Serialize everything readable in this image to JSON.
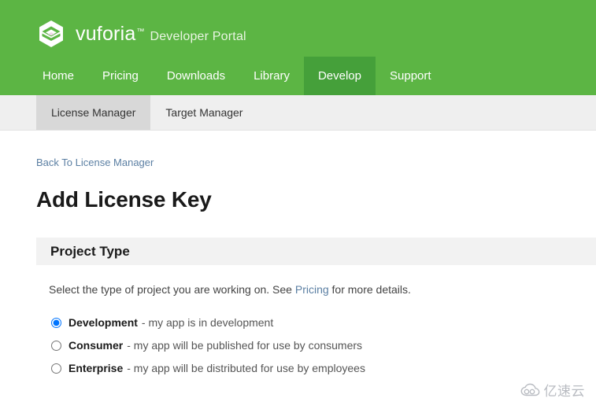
{
  "brand": {
    "logo_icon": "vuforia-hexagon-layers-logo",
    "name": "vuforia",
    "trademark": "™",
    "subtitle": "Developer Portal"
  },
  "colors": {
    "nav_green": "#5cb544",
    "nav_green_active": "#45a03a",
    "link_blue": "#5b7fa3",
    "subnav_bg": "#efefef",
    "subnav_tab_active": "#d8d8d8",
    "card_header_bg": "#f2f2f2"
  },
  "main_nav": {
    "items": [
      {
        "label": "Home",
        "active": false
      },
      {
        "label": "Pricing",
        "active": false
      },
      {
        "label": "Downloads",
        "active": false
      },
      {
        "label": "Library",
        "active": false
      },
      {
        "label": "Develop",
        "active": true
      },
      {
        "label": "Support",
        "active": false
      }
    ]
  },
  "sub_nav": {
    "tabs": [
      {
        "label": "License Manager",
        "active": true
      },
      {
        "label": "Target Manager",
        "active": false
      }
    ]
  },
  "page": {
    "breadcrumb_label": "Back To License Manager",
    "title": "Add License Key"
  },
  "project_type": {
    "header": "Project Type",
    "intro_before": "Select the type of project you are working on. See",
    "intro_link": "Pricing",
    "intro_after": "for more details.",
    "options": [
      {
        "label": "Development",
        "description": "- my app is in development",
        "selected": true
      },
      {
        "label": "Consumer",
        "description": "- my app will be published for use by consumers",
        "selected": false
      },
      {
        "label": "Enterprise",
        "description": "- my app will be distributed for use by employees",
        "selected": false
      }
    ]
  },
  "watermark": {
    "icon": "cloud-icon",
    "text": "亿速云"
  }
}
